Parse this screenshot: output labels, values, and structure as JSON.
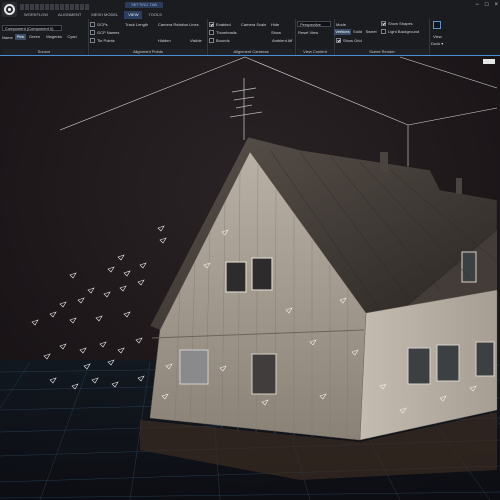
{
  "app": {
    "context_tab": "SETTING TAB",
    "tabs": [
      "WORKFLOW",
      "ALIGNMENT",
      "MESH MODEL",
      "VIEW",
      "TOOLS"
    ],
    "active_tab": "VIEW",
    "window_controls": [
      "−",
      "□",
      "×"
    ]
  },
  "source": {
    "component_value": "Component (Component 0)",
    "name_label": "Name",
    "colors": [
      "Pink",
      "Green",
      "Magenta",
      "Cyan"
    ],
    "selected_color": "Pink",
    "label": "Source"
  },
  "alignment_points": {
    "checks": [
      {
        "label": "GCPs",
        "checked": false
      },
      {
        "label": "GCP Names",
        "checked": false
      },
      {
        "label": "Tie Points",
        "checked": false
      }
    ],
    "track_length_label": "Track Length",
    "camera_relation_lines_label": "Camera Relation Lines",
    "hidden_label": "Hidden",
    "visible_label": "Visible",
    "label": "Alignment Points"
  },
  "alignment_cameras": {
    "checks": [
      {
        "label": "Enabled",
        "checked": true
      },
      {
        "label": "Thumbnails",
        "checked": false
      },
      {
        "label": "Bounds",
        "checked": false
      }
    ],
    "camera_scale_label": "Camera Scale",
    "hide_label": "Hide",
    "show_label": "Show",
    "label": "Alignment Cameras"
  },
  "view_content": {
    "projection_value": "Perspective",
    "reset_view_label": "Reset View",
    "ambient_label": "Ambient Aff",
    "label": "View Content"
  },
  "scene_render": {
    "mode_label": "Mode",
    "modes": [
      "Vertices",
      "Solid",
      "Sweet"
    ],
    "selected_mode": "Vertices",
    "checks": [
      {
        "label": "Show Shapes",
        "checked": true
      },
      {
        "label": "Light Background",
        "checked": false
      },
      {
        "label": "Show Grid",
        "checked": true
      }
    ],
    "label": "Scene Render"
  },
  "view_menu": {
    "label": "View",
    "sublabel": "Dock ▾"
  },
  "colors": {
    "ribbon_bg": "#1b1c20",
    "accent": "#4a90d9",
    "tab_active": "#2d3f5e"
  }
}
